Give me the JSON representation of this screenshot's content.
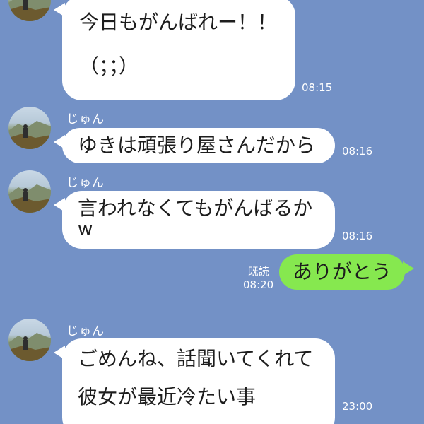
{
  "messages": [
    {
      "lines": [
        "今日もがんばれー！！",
        "（；；）"
      ],
      "time": "08:15"
    },
    {
      "sender": "じゅん",
      "lines": [
        "ゆきは頑張り屋さんだから"
      ],
      "time": "08:16"
    },
    {
      "sender": "じゅん",
      "lines": [
        "言われなくてもがんばるか",
        "w"
      ],
      "time": "08:16"
    },
    {
      "lines": [
        "ありがとう"
      ],
      "read": "既読",
      "time": "08:20"
    },
    {
      "sender": "じゅん",
      "lines": [
        "ごめんね、話聞いてくれて",
        "彼女が最近冷たい事"
      ],
      "time": "23:00"
    }
  ],
  "colors": {
    "background": "#7391c6",
    "incoming_bubble": "#ffffff",
    "outgoing_bubble": "#86e84f"
  }
}
